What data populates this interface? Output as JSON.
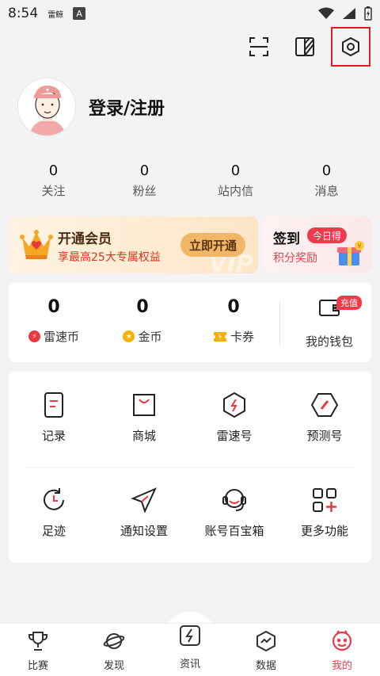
{
  "status_bar": {
    "time": "8:54",
    "app_small": "雷鲸",
    "app_badge": "A"
  },
  "top_icons": [
    "scan-icon",
    "theme-icon",
    "settings-icon"
  ],
  "profile": {
    "login_label": "登录/注册"
  },
  "stats": [
    {
      "num": "0",
      "label": "关注"
    },
    {
      "num": "0",
      "label": "粉丝"
    },
    {
      "num": "0",
      "label": "站内信"
    },
    {
      "num": "0",
      "label": "消息"
    }
  ],
  "vip": {
    "title": "开通会员",
    "subtitle": "享最高25大专属权益",
    "button": "立即开通",
    "watermark": "VIP"
  },
  "checkin": {
    "title": "签到",
    "badge": "今日得",
    "subtitle": "积分奖励"
  },
  "wallet": {
    "items": [
      {
        "num": "0",
        "label": "雷速币"
      },
      {
        "num": "0",
        "label": "金币"
      },
      {
        "num": "0",
        "label": "卡券"
      }
    ],
    "my_wallet": "我的钱包",
    "recharge_badge": "充值"
  },
  "grid": [
    {
      "label": "记录",
      "icon": "record-icon"
    },
    {
      "label": "商城",
      "icon": "shop-icon"
    },
    {
      "label": "雷速号",
      "icon": "leisu-account-icon"
    },
    {
      "label": "预测号",
      "icon": "prediction-icon"
    },
    {
      "label": "足迹",
      "icon": "history-icon"
    },
    {
      "label": "通知设置",
      "icon": "notification-icon"
    },
    {
      "label": "账号百宝箱",
      "icon": "support-icon"
    },
    {
      "label": "更多功能",
      "icon": "more-features-icon"
    }
  ],
  "tabbar": [
    {
      "label": "比赛",
      "icon": "trophy-icon"
    },
    {
      "label": "发现",
      "icon": "discover-icon"
    },
    {
      "label": "资讯",
      "icon": "news-icon"
    },
    {
      "label": "数据",
      "icon": "data-icon"
    },
    {
      "label": "我的",
      "icon": "profile-icon",
      "active": true
    }
  ],
  "colors": {
    "accent": "#ec3b4b",
    "vip_button": "#f2b667"
  }
}
